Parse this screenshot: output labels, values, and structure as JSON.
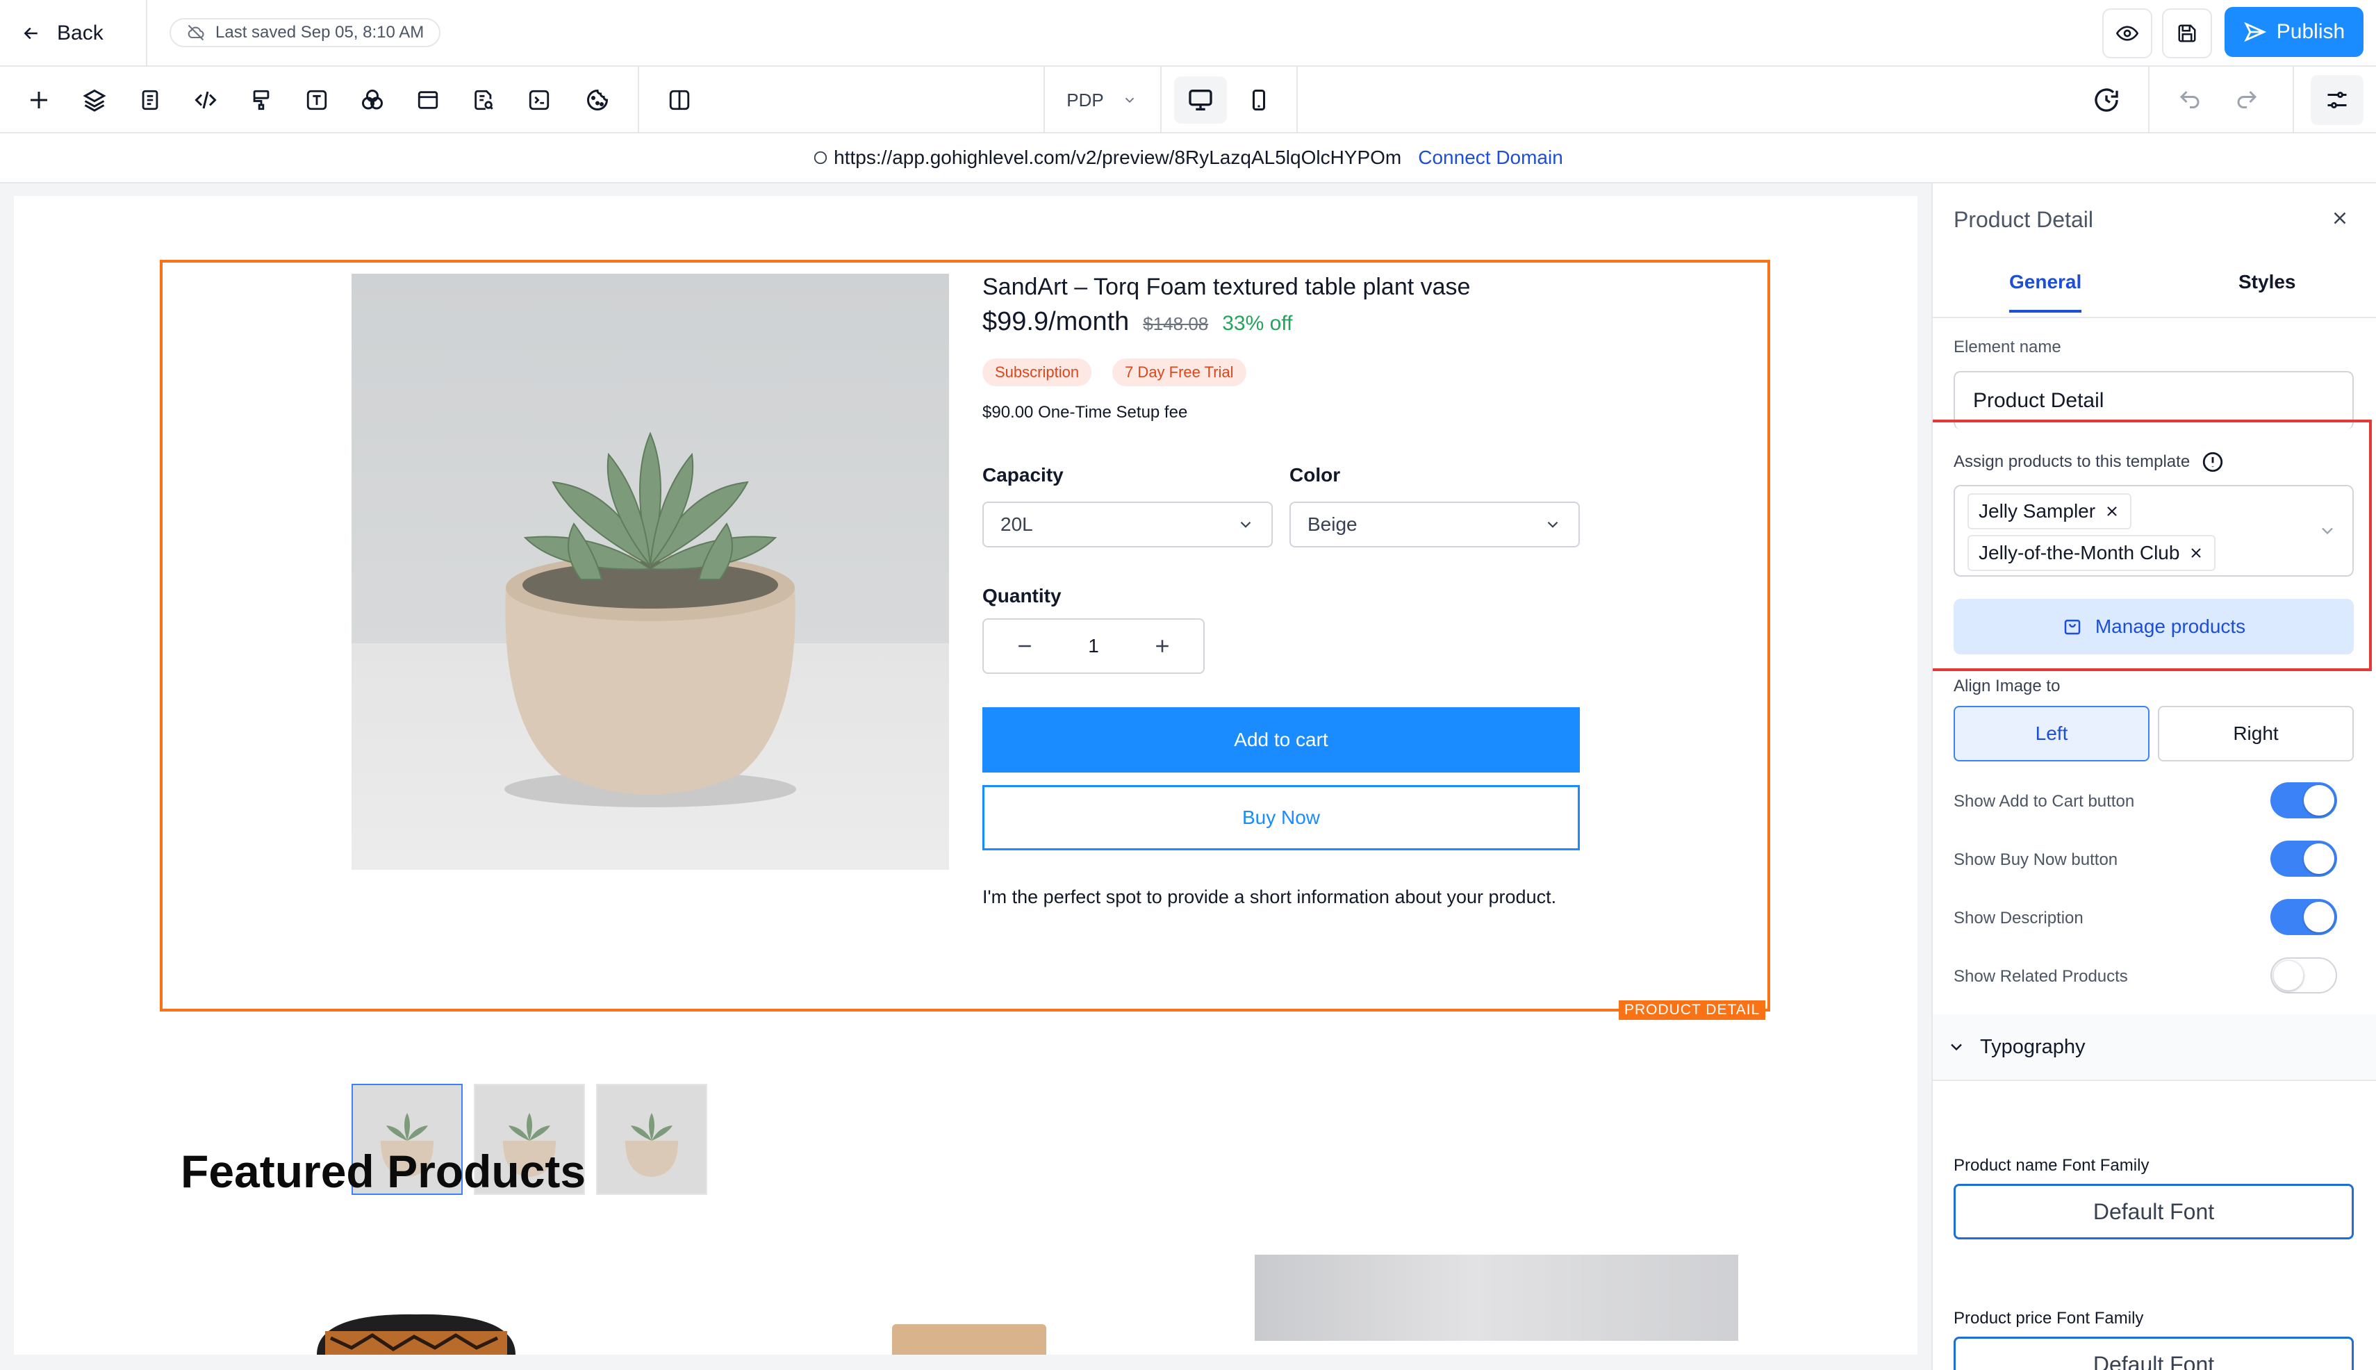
{
  "topbar": {
    "back_label": "Back",
    "save_status": "Last saved Sep 05, 8:10 AM",
    "publish_label": "Publish"
  },
  "toolbar": {
    "page_select": "PDP"
  },
  "urlbar": {
    "url": "https://app.gohighlevel.com/v2/preview/8RyLazqAL5lqOlcHYPOm",
    "connect_domain": "Connect Domain"
  },
  "product": {
    "name": "SandArt – Torq Foam textured table plant vase",
    "price": "$99.9/month",
    "compare_price": "$148.08",
    "discount": "33% off",
    "badge_subscription": "Subscription",
    "badge_trial": "7 Day Free Trial",
    "setup_fee": "$90.00 One-Time Setup fee",
    "capacity_label": "Capacity",
    "capacity_value": "20L",
    "color_label": "Color",
    "color_value": "Beige",
    "quantity_label": "Quantity",
    "quantity_value": "1",
    "add_to_cart": "Add to cart",
    "buy_now": "Buy Now",
    "description": "I'm the perfect spot to provide a short information about your product.",
    "element_tag": "PRODUCT DETAIL"
  },
  "featured": {
    "heading": "Featured Products"
  },
  "panel": {
    "title": "Product Detail",
    "tabs": [
      "General",
      "Styles"
    ],
    "element_name_label": "Element name",
    "element_name_value": "Product Detail",
    "assign_label": "Assign products to this template",
    "assigned_products": [
      "Jelly Sampler",
      "Jelly-of-the-Month Club"
    ],
    "manage_products": "Manage products",
    "align_label": "Align Image to",
    "align_options": [
      "Left",
      "Right"
    ],
    "align_selected": "Left",
    "toggles": [
      {
        "label": "Show Add to Cart button",
        "on": true
      },
      {
        "label": "Show Buy Now button",
        "on": true
      },
      {
        "label": "Show Description",
        "on": true
      },
      {
        "label": "Show Related Products",
        "on": false
      }
    ],
    "typography_label": "Typography",
    "name_font_label": "Product name Font Family",
    "name_font_value": "Default Font",
    "price_font_label": "Product price Font Family",
    "price_font_value": "Default Font"
  },
  "colors": {
    "accent": "#1a8cff",
    "primary_blue": "#2563eb",
    "selection_orange": "#f97316",
    "highlight_red": "#e53935",
    "discount_green": "#22a55b",
    "badge_bg": "#fde8e4",
    "badge_text": "#d9481c"
  }
}
